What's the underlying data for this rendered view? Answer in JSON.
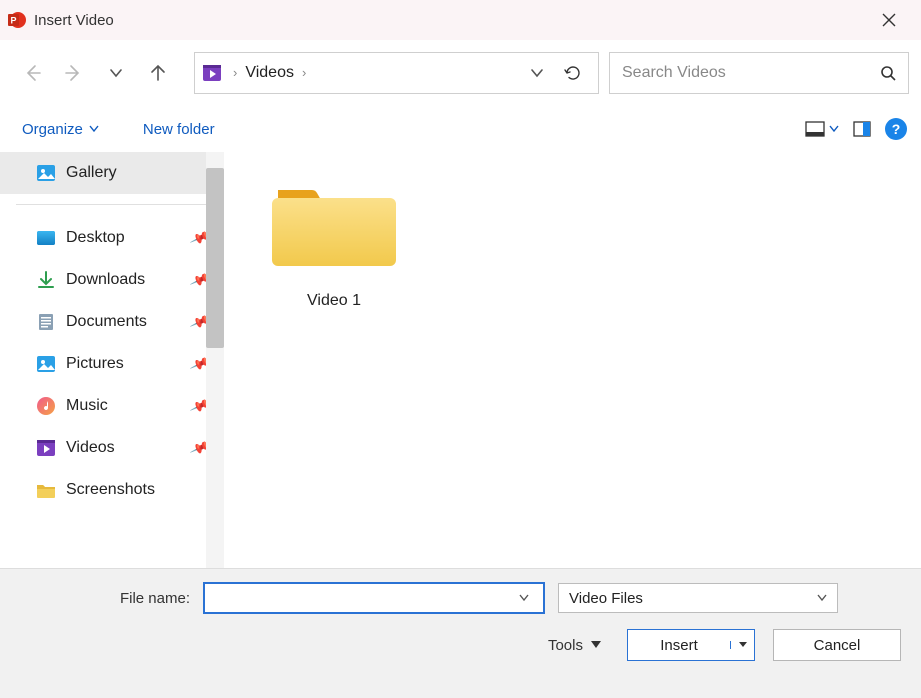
{
  "window": {
    "title": "Insert Video"
  },
  "breadcrumb": {
    "current": "Videos"
  },
  "search": {
    "placeholder": "Search Videos"
  },
  "commands": {
    "organize": "Organize",
    "newfolder": "New folder"
  },
  "sidebar": {
    "items": [
      {
        "label": "Gallery"
      },
      {
        "label": "Desktop"
      },
      {
        "label": "Downloads"
      },
      {
        "label": "Documents"
      },
      {
        "label": "Pictures"
      },
      {
        "label": "Music"
      },
      {
        "label": "Videos"
      },
      {
        "label": "Screenshots"
      }
    ]
  },
  "content": {
    "items": [
      {
        "label": "Video 1"
      }
    ]
  },
  "footer": {
    "fn_label": "File name:",
    "fn_value": "",
    "filter": "Video Files",
    "tools": "Tools",
    "insert": "Insert",
    "cancel": "Cancel"
  },
  "help": "?"
}
